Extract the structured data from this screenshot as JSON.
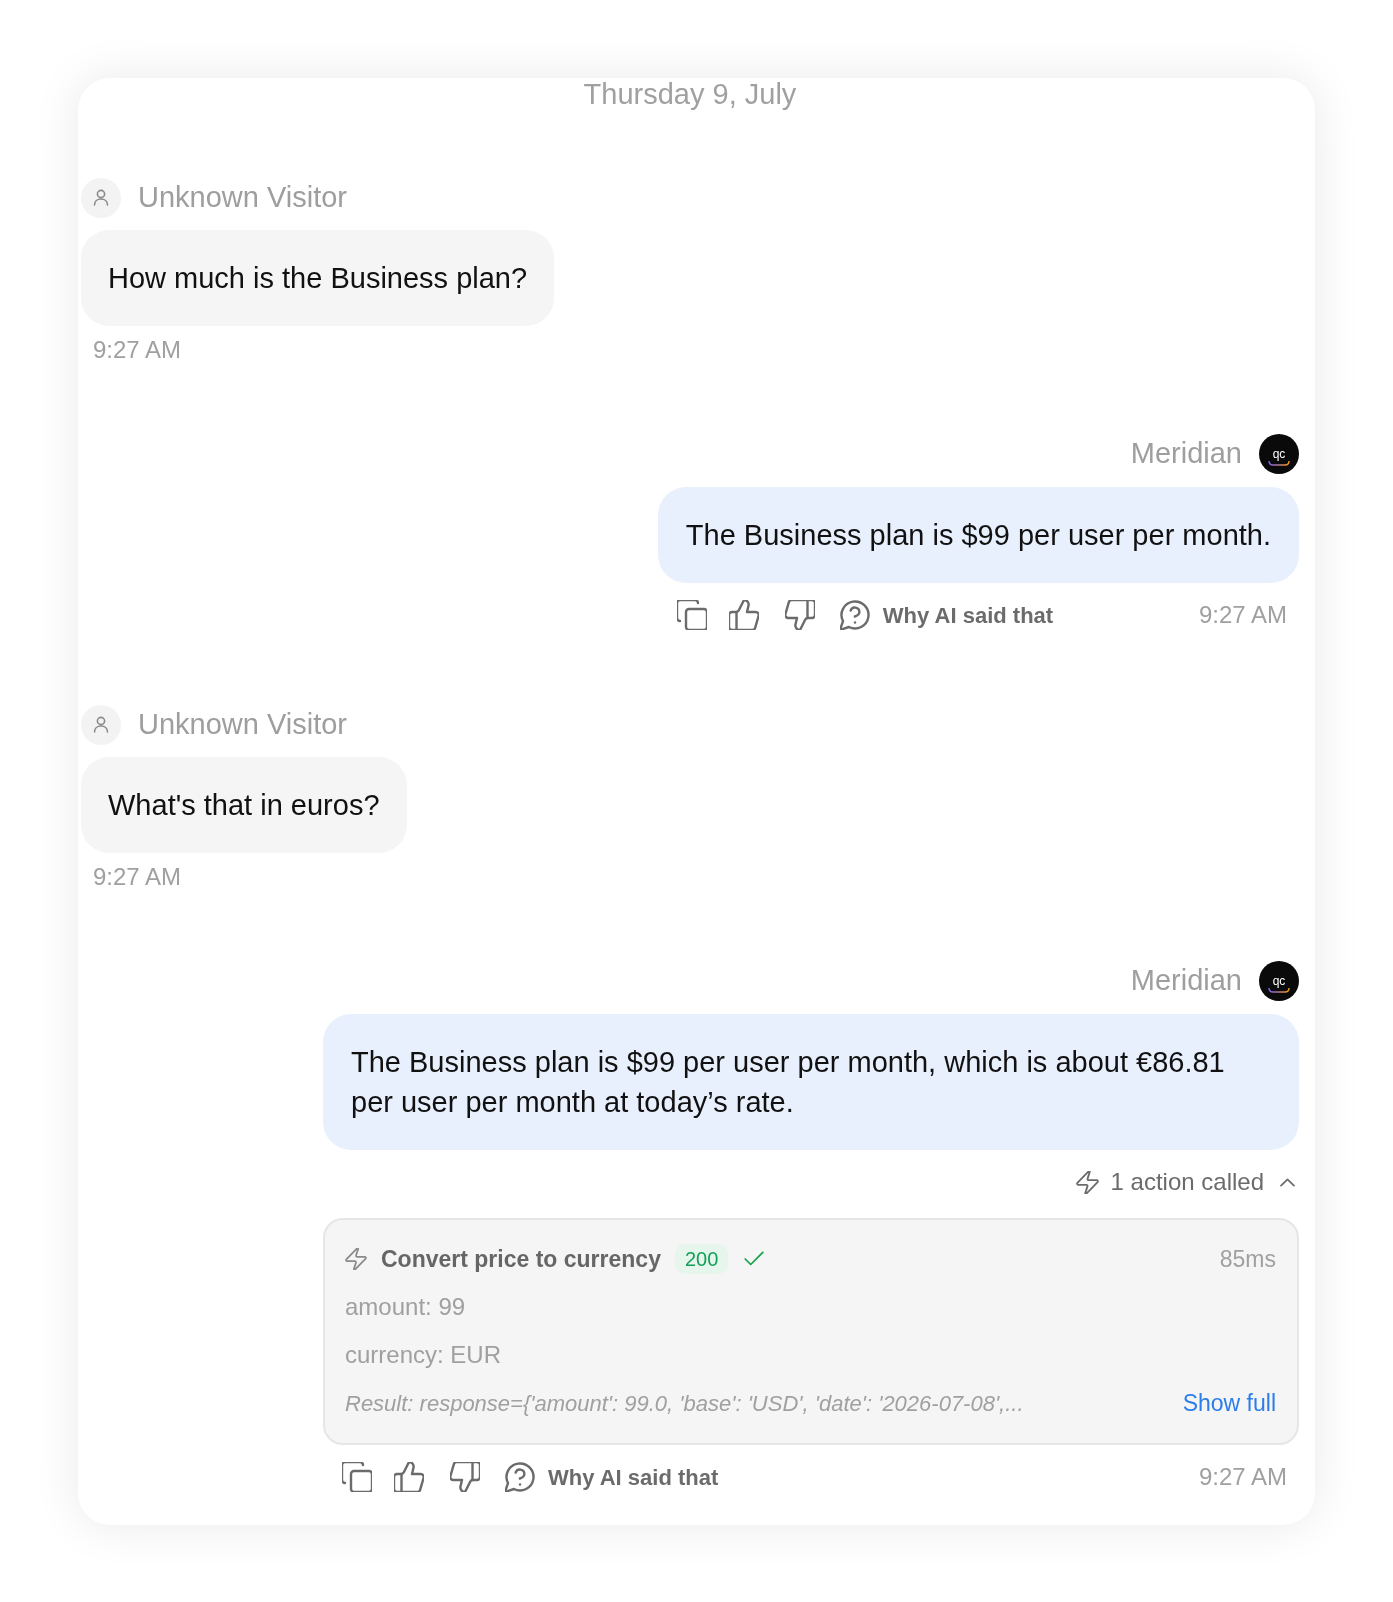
{
  "date_divider": "Thursday 9, July",
  "messages": [
    {
      "kind": "visitor",
      "sender": "Unknown Visitor",
      "text": "How much is the Business plan?",
      "time": "9:27 AM"
    },
    {
      "kind": "bot",
      "sender": "Meridian",
      "avatar_text": "qc",
      "text": "The Business plan is $99 per user per month.",
      "why_label": "Why AI said that",
      "time": "9:27 AM"
    },
    {
      "kind": "visitor",
      "sender": "Unknown Visitor",
      "text": "What's that in euros?",
      "time": "9:27 AM"
    },
    {
      "kind": "bot",
      "sender": "Meridian",
      "avatar_text": "qc",
      "text": "The Business plan is $99 per user per month, which is about €86.81 per user per month at today’s rate.",
      "actions_summary": {
        "label": "1 action called",
        "expanded": true
      },
      "tool_calls": [
        {
          "name": "Convert price to currency",
          "status": "200",
          "success": true,
          "duration": "85ms",
          "params": [
            "amount: 99",
            "currency: EUR"
          ],
          "result": "Result: response={'amount': 99.0, 'base': 'USD', 'date': '2026-07-08',...",
          "show_full": "Show full"
        }
      ],
      "why_label": "Why AI said that",
      "time": "9:27 AM"
    }
  ]
}
